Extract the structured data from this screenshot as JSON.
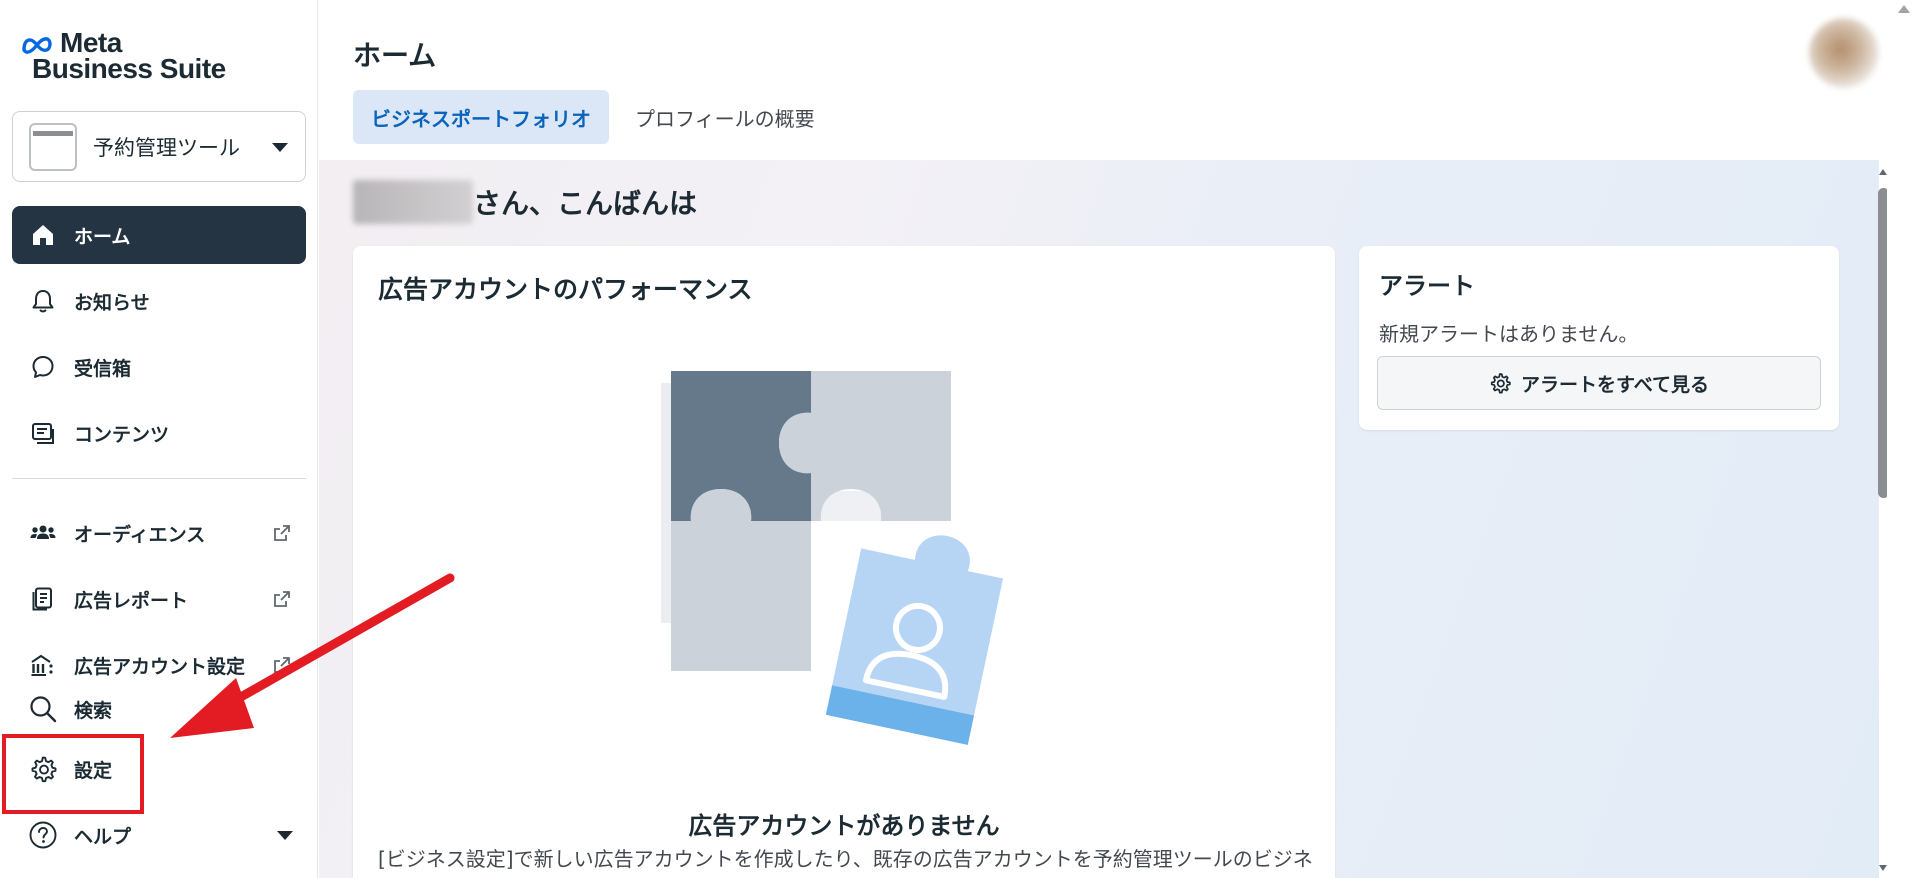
{
  "app": {
    "logo_line1": "Meta",
    "logo_line2": "Business Suite"
  },
  "portfolio_selector": {
    "name": "予約管理ツール"
  },
  "sidebar": {
    "items": [
      {
        "label": "ホーム",
        "icon": "home-icon",
        "active": true
      },
      {
        "label": "お知らせ",
        "icon": "bell-icon"
      },
      {
        "label": "受信箱",
        "icon": "chat-bubble-icon"
      },
      {
        "label": "コンテンツ",
        "icon": "content-icon"
      },
      {
        "label": "オーディエンス",
        "icon": "audience-icon",
        "external": true
      },
      {
        "label": "広告レポート",
        "icon": "report-icon",
        "external": true
      },
      {
        "label": "広告アカウント設定",
        "icon": "ad-account-icon",
        "external": true
      },
      {
        "label": "検索",
        "icon": "search-icon"
      },
      {
        "label": "設定",
        "icon": "gear-icon",
        "highlighted": true
      },
      {
        "label": "ヘルプ",
        "icon": "help-icon",
        "has_dropdown": true
      }
    ]
  },
  "header": {
    "title": "ホーム",
    "tabs": [
      {
        "label": "ビジネスポートフォリオ",
        "selected": true
      },
      {
        "label": "プロフィールの概要",
        "selected": false
      }
    ]
  },
  "main": {
    "greeting_suffix": "さん、こんばんは",
    "performance_card": {
      "title": "広告アカウントのパフォーマンス",
      "empty_title": "広告アカウントがありません",
      "empty_desc": "[ビジネス設定]で新しい広告アカウントを作成したり、既存の広告アカウントを予約管理ツールのビジネスポートフォリオに追加したりできます。"
    },
    "alerts_card": {
      "title": "アラート",
      "message": "新規アラートはありません。",
      "button_label": "アラートをすべて見る"
    }
  },
  "colors": {
    "active_nav_bg": "#243442",
    "selected_tab_bg": "#dbe7f6",
    "selected_tab_text": "#0a64bc",
    "annotation_red": "#e31b23",
    "meta_blue": "#0668e1"
  }
}
